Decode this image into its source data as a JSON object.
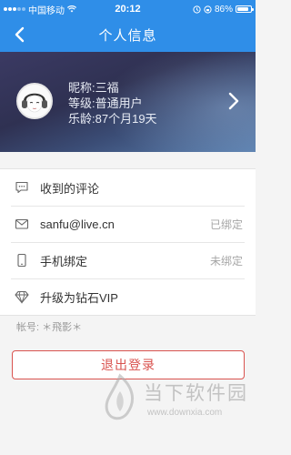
{
  "status_bar": {
    "carrier": "中国移动",
    "time": "20:12",
    "battery": "86%",
    "battery_level": 0.86
  },
  "nav": {
    "title": "个人信息",
    "back_icon": "chevron-left-icon"
  },
  "profile": {
    "nickname_label": "昵称:",
    "nickname": "三福",
    "level_label": "等级:",
    "level": "普通用户",
    "age_label": "乐龄:",
    "age": "87个月19天"
  },
  "list": [
    {
      "icon": "comment-icon",
      "label": "收到的评论",
      "value": ""
    },
    {
      "icon": "mail-icon",
      "label": "sanfu@live.cn",
      "value": "已绑定"
    },
    {
      "icon": "phone-icon",
      "label": "手机绑定",
      "value": "未绑定"
    },
    {
      "icon": "diamond-icon",
      "label": "升级为钻石VIP",
      "value": ""
    }
  ],
  "account": {
    "label": "帐号:",
    "value": "＊飛影＊"
  },
  "logout_label": "退出登录",
  "watermark": {
    "text": "当下软件园",
    "url": "www.downxia.com"
  },
  "colors": {
    "accent": "#2f8ee8",
    "danger": "#d9534f"
  }
}
